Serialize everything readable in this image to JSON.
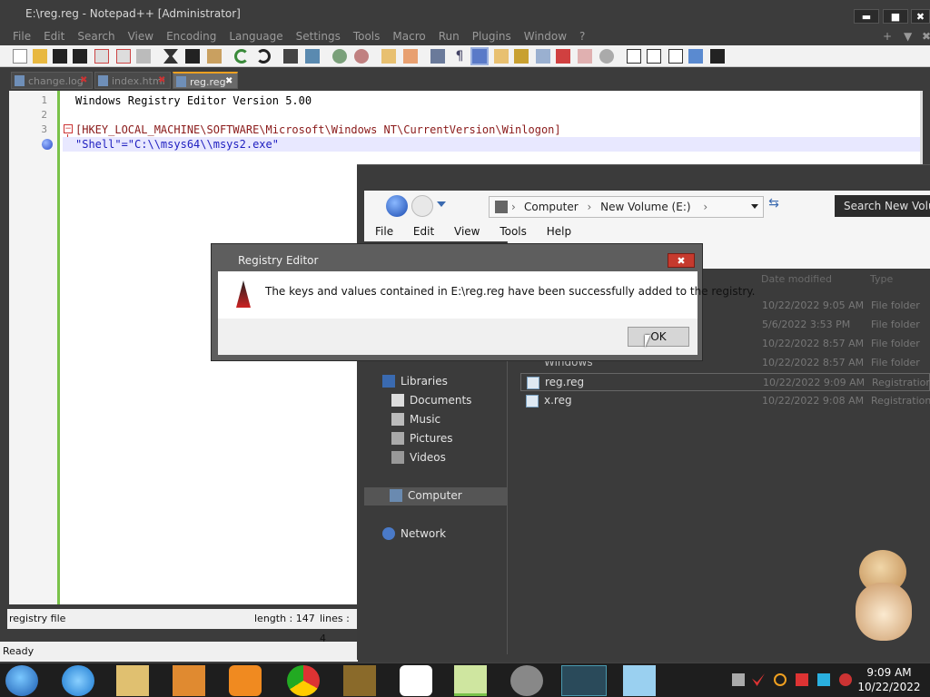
{
  "npp": {
    "title": "E:\\reg.reg - Notepad++ [Administrator]",
    "menu": [
      "File",
      "Edit",
      "Search",
      "View",
      "Encoding",
      "Language",
      "Settings",
      "Tools",
      "Macro",
      "Run",
      "Plugins",
      "Window",
      "?"
    ],
    "window_buttons": {
      "minimize": "▬",
      "maximize": "■",
      "close": "✖"
    },
    "menu_right": {
      "plus": "+",
      "down": "▼",
      "close": "✖"
    },
    "tabs": [
      {
        "label": "change.log"
      },
      {
        "label": "index.html"
      },
      {
        "label": "reg.reg"
      }
    ],
    "lines": [
      {
        "num": "1",
        "text": "Windows Registry Editor Version 5.00"
      },
      {
        "num": "2",
        "text": ""
      },
      {
        "num": "3",
        "text": "[HKEY_LOCAL_MACHINE\\SOFTWARE\\Microsoft\\Windows NT\\CurrentVersion\\Winlogon]"
      },
      {
        "num": "4",
        "text": "\"Shell\"=\"C:\\\\msys64\\\\msys2.exe\""
      }
    ],
    "status": {
      "type": "registry file",
      "length": "length : 147",
      "lines": "lines : 4"
    },
    "ready": "Ready"
  },
  "explorer": {
    "address": [
      "Computer",
      "New Volume (E:)"
    ],
    "search_placeholder": "Search New Volume (E:)",
    "menu": [
      "File",
      "Edit",
      "View",
      "Tools",
      "Help"
    ],
    "columns": {
      "date": "Date modified",
      "type": "Type"
    },
    "files": [
      {
        "name": "",
        "date": "10/22/2022 9:05 AM",
        "type": "File folder"
      },
      {
        "name": "",
        "date": "5/6/2022 3:53 PM",
        "type": "File folder"
      },
      {
        "name": "",
        "date": "10/22/2022 8:57 AM",
        "type": "File folder"
      },
      {
        "name": "Windows",
        "date": "10/22/2022 8:57 AM",
        "type": "File folder"
      },
      {
        "name": "reg.reg",
        "date": "10/22/2022 9:09 AM",
        "type": "Registration"
      },
      {
        "name": "x.reg",
        "date": "10/22/2022 9:08 AM",
        "type": "Registration"
      }
    ],
    "nav": {
      "libraries": "Libraries",
      "documents": "Documents",
      "music": "Music",
      "pictures": "Pictures",
      "videos": "Videos",
      "computer": "Computer",
      "network": "Network"
    }
  },
  "dialog": {
    "title": "Registry Editor",
    "message": "The keys and values contained in E:\\reg.reg have been successfully added to the registry.",
    "ok": "OK",
    "close": "✖"
  },
  "taskbar": {
    "time": "9:09 AM",
    "date": "10/22/2022",
    "apps": [
      "start-orb",
      "internet-explorer",
      "file-explorer",
      "media-player",
      "uc-browser",
      "chrome",
      "gom-player",
      "stopwatch",
      "notepad-plus-plus",
      "film-reel",
      "registry-cube",
      "notepad"
    ]
  },
  "colors": {
    "accent_green": "#7ac24a",
    "tab_active": "#f0a020",
    "close_red": "#c63a2e",
    "string_blue": "#0000ff",
    "key_red": "#cc2222"
  }
}
